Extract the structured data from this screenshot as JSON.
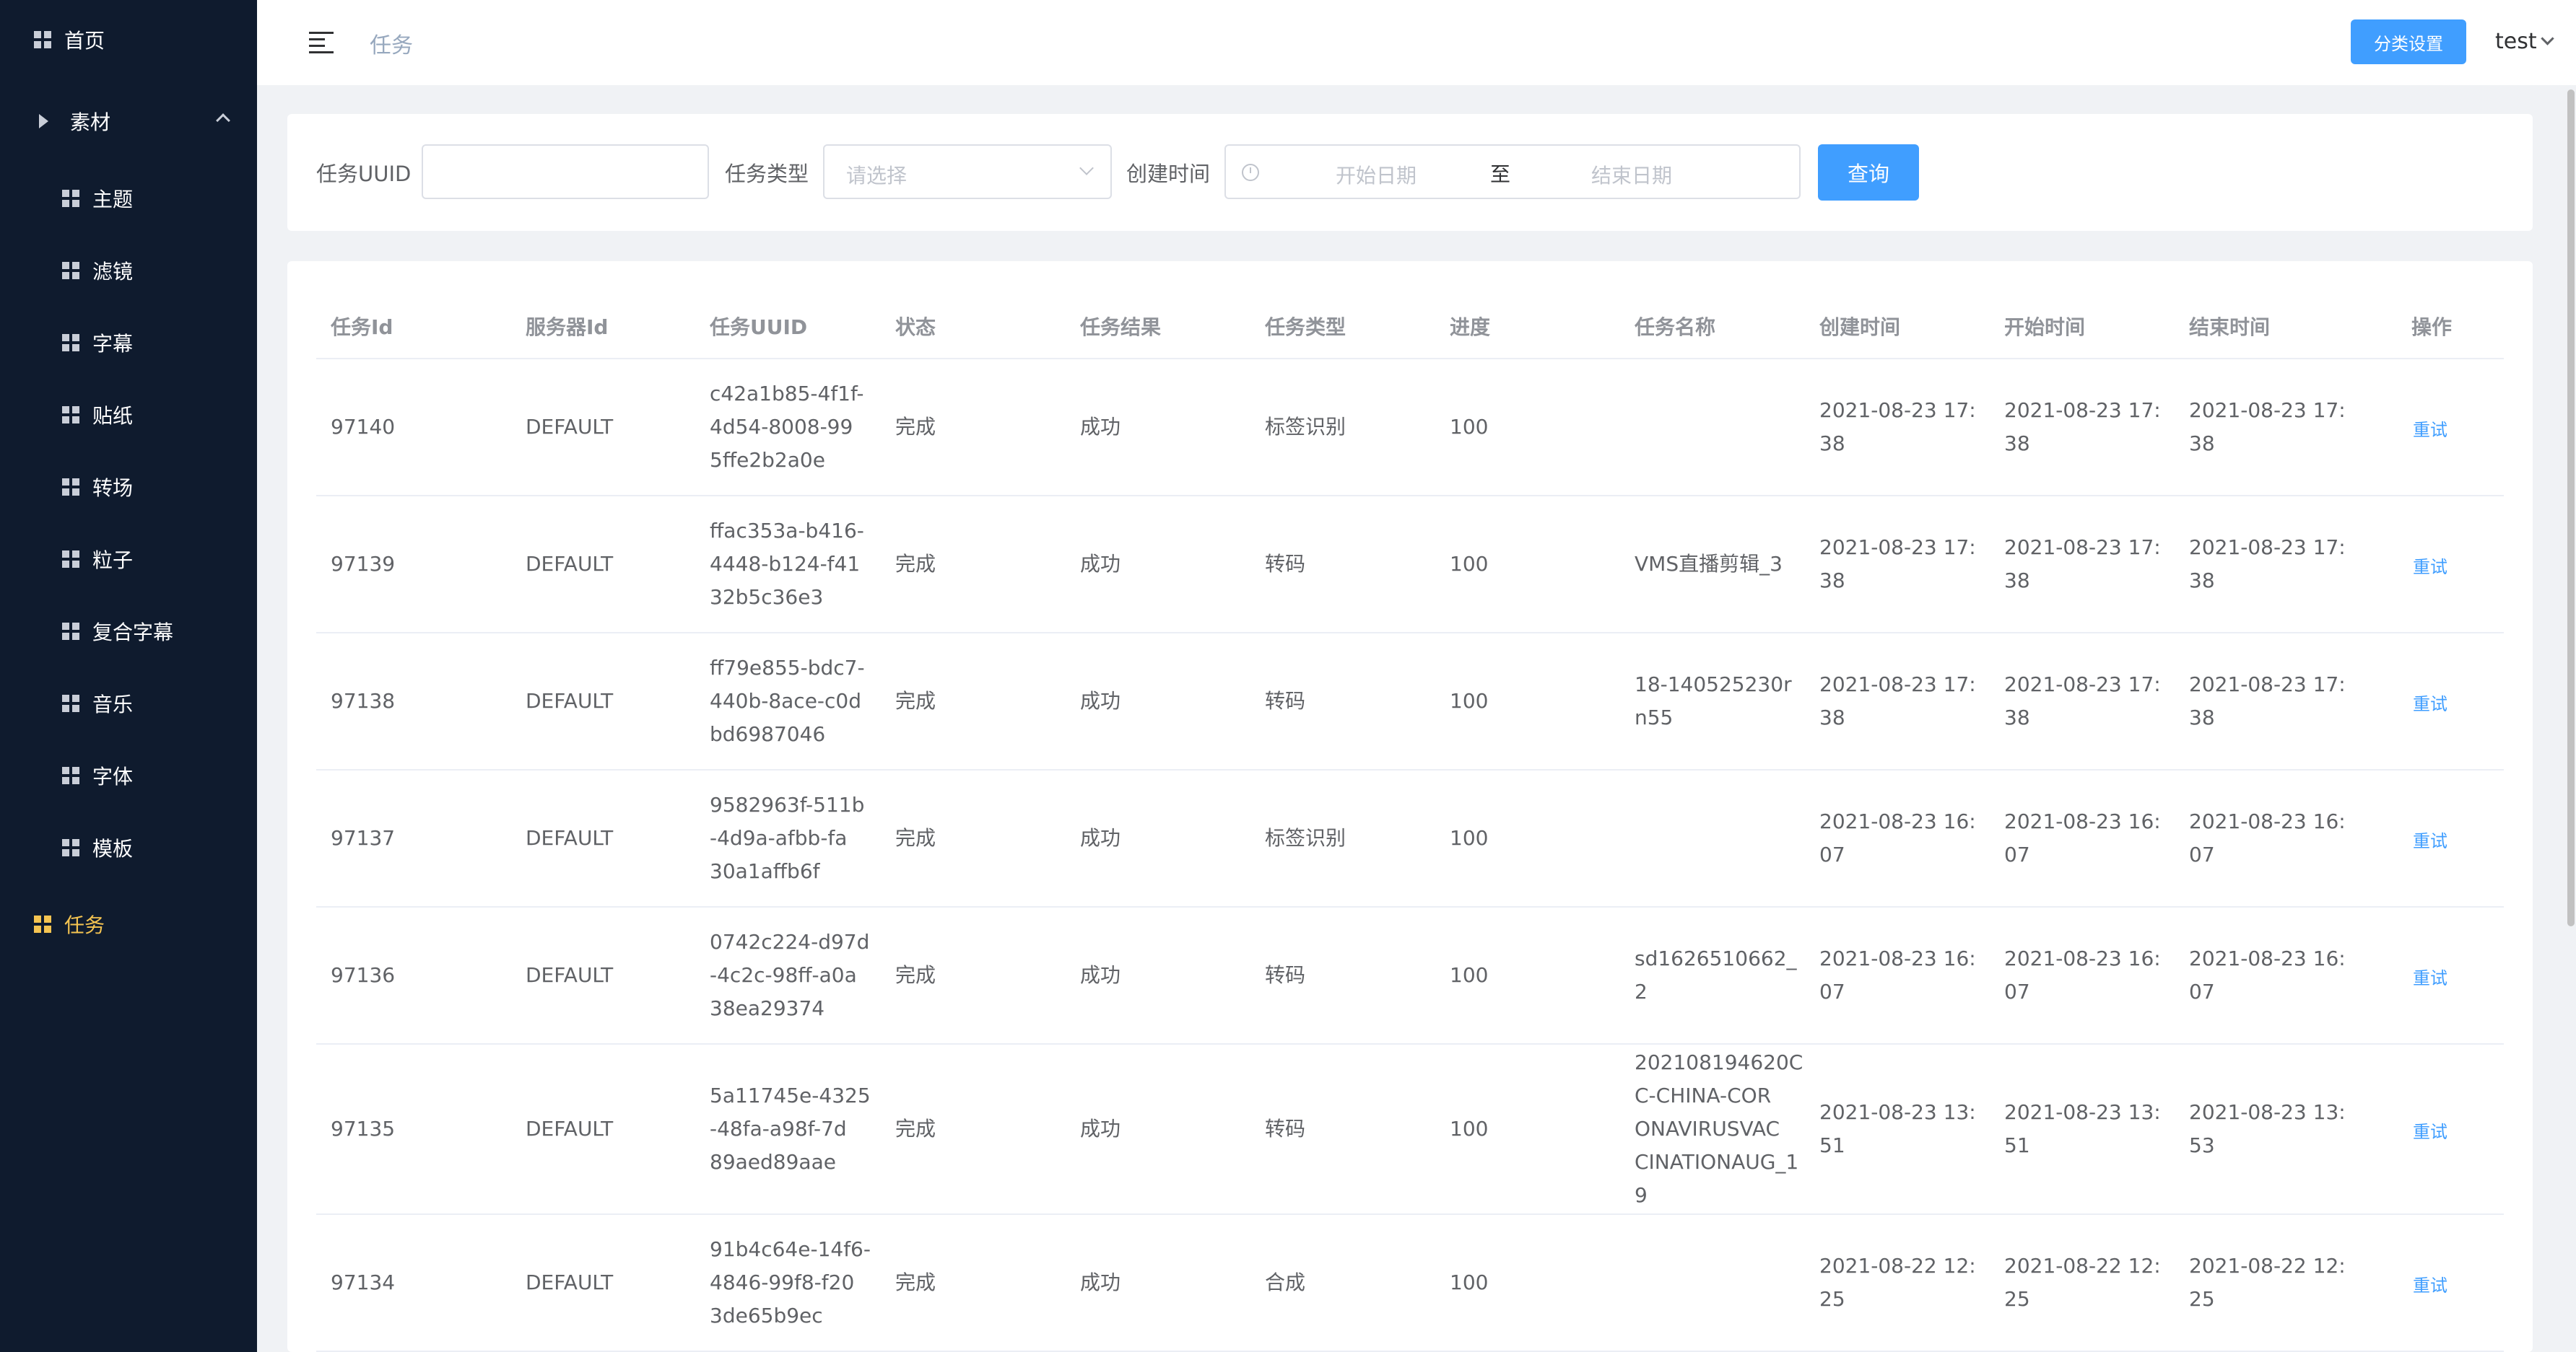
{
  "sidebar": {
    "home": "首页",
    "material": "素材",
    "children": [
      "主题",
      "滤镜",
      "字幕",
      "贴纸",
      "转场",
      "粒子",
      "复合字幕",
      "音乐",
      "字体",
      "模板"
    ],
    "task": "任务"
  },
  "header": {
    "breadcrumb": "任务",
    "category_button": "分类设置",
    "user": "test"
  },
  "filter": {
    "uuid_label": "任务UUID",
    "uuid_value": "",
    "type_label": "任务类型",
    "type_placeholder": "请选择",
    "time_label": "创建时间",
    "start_placeholder": "开始日期",
    "range_separator": "至",
    "end_placeholder": "结束日期",
    "query_button": "查询"
  },
  "table": {
    "columns": [
      "任务Id",
      "服务器Id",
      "任务UUID",
      "状态",
      "任务结果",
      "任务类型",
      "进度",
      "任务名称",
      "创建时间",
      "开始时间",
      "结束时间",
      "操作"
    ],
    "retry_label": "重试",
    "rows": [
      {
        "id": "97140",
        "server": "DEFAULT",
        "uuid": [
          "c42a1b85-4f1f-",
          "4d54-8008-99",
          "5ffe2b2a0e"
        ],
        "status": "完成",
        "result": "成功",
        "type": "标签识别",
        "progress": "100",
        "name": [],
        "created": [
          "2021-08-23 17:",
          "38"
        ],
        "started": [
          "2021-08-23 17:",
          "38"
        ],
        "ended": [
          "2021-08-23 17:",
          "38"
        ]
      },
      {
        "id": "97139",
        "server": "DEFAULT",
        "uuid": [
          "ffac353a-b416-",
          "4448-b124-f41",
          "32b5c36e3"
        ],
        "status": "完成",
        "result": "成功",
        "type": "转码",
        "progress": "100",
        "name": [
          "VMS直播剪辑_3"
        ],
        "created": [
          "2021-08-23 17:",
          "38"
        ],
        "started": [
          "2021-08-23 17:",
          "38"
        ],
        "ended": [
          "2021-08-23 17:",
          "38"
        ]
      },
      {
        "id": "97138",
        "server": "DEFAULT",
        "uuid": [
          "ff79e855-bdc7-",
          "440b-8ace-c0d",
          "bd6987046"
        ],
        "status": "完成",
        "result": "成功",
        "type": "转码",
        "progress": "100",
        "name": [
          "18-140525230r",
          "n55"
        ],
        "created": [
          "2021-08-23 17:",
          "38"
        ],
        "started": [
          "2021-08-23 17:",
          "38"
        ],
        "ended": [
          "2021-08-23 17:",
          "38"
        ]
      },
      {
        "id": "97137",
        "server": "DEFAULT",
        "uuid": [
          "9582963f-511b",
          "-4d9a-afbb-fa",
          "30a1affb6f"
        ],
        "status": "完成",
        "result": "成功",
        "type": "标签识别",
        "progress": "100",
        "name": [],
        "created": [
          "2021-08-23 16:",
          "07"
        ],
        "started": [
          "2021-08-23 16:",
          "07"
        ],
        "ended": [
          "2021-08-23 16:",
          "07"
        ]
      },
      {
        "id": "97136",
        "server": "DEFAULT",
        "uuid": [
          "0742c224-d97d",
          "-4c2c-98ff-a0a",
          "38ea29374"
        ],
        "status": "完成",
        "result": "成功",
        "type": "转码",
        "progress": "100",
        "name": [
          "sd1626510662_",
          "2"
        ],
        "created": [
          "2021-08-23 16:",
          "07"
        ],
        "started": [
          "2021-08-23 16:",
          "07"
        ],
        "ended": [
          "2021-08-23 16:",
          "07"
        ]
      },
      {
        "id": "97135",
        "server": "DEFAULT",
        "uuid": [
          "5a11745e-4325",
          "-48fa-a98f-7d",
          "89aed89aae"
        ],
        "status": "完成",
        "result": "成功",
        "type": "转码",
        "progress": "100",
        "name": [
          "202108194620C",
          "C-CHINA-COR",
          "ONAVIRUSVAC",
          "CINATIONAUG_1",
          "9"
        ],
        "created": [
          "2021-08-23 13:",
          "51"
        ],
        "started": [
          "2021-08-23 13:",
          "51"
        ],
        "ended": [
          "2021-08-23 13:",
          "53"
        ]
      },
      {
        "id": "97134",
        "server": "DEFAULT",
        "uuid": [
          "91b4c64e-14f6-",
          "4846-99f8-f20",
          "3de65b9ec"
        ],
        "status": "完成",
        "result": "成功",
        "type": "合成",
        "progress": "100",
        "name": [],
        "created": [
          "2021-08-22 12:",
          "25"
        ],
        "started": [
          "2021-08-22 12:",
          "25"
        ],
        "ended": [
          "2021-08-22 12:",
          "25"
        ]
      }
    ]
  }
}
